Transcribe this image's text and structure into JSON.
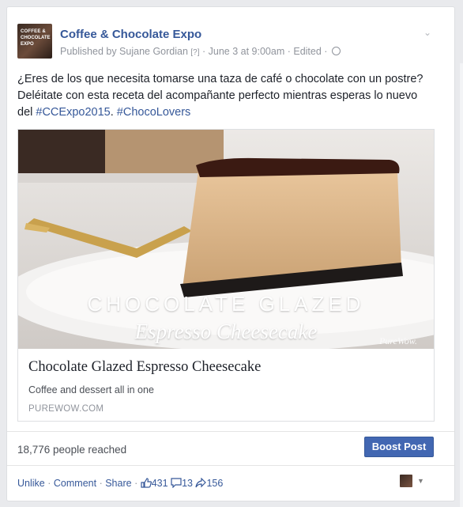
{
  "post": {
    "page_name": "Coffee & Chocolate Expo",
    "avatar_text": [
      "COFFEE &",
      "CHOCOLATE",
      "EXPO"
    ],
    "published_by": "Published by Sujane Gordian",
    "help_marker": "[?]",
    "date": "June 3 at 9:00am",
    "edited": "Edited",
    "text_main": "¿Eres de los que necesita tomarse una taza de café o chocolate con un postre? Deléitate con esta receta del acompañante perfecto mientras esperas lo nuevo del ",
    "hashtag1": "#CCExpo2015",
    "hashtag2": "#ChocoLovers",
    "privacy_icon": "globe-icon"
  },
  "link_card": {
    "image_title_line1": "CHOCOLATE GLAZED",
    "image_title_line2": "Espresso Cheesecake",
    "watermark": "PureWow.",
    "title": "Chocolate Glazed Espresso Cheesecake",
    "description": "Coffee and dessert all in one",
    "domain": "PUREWOW.COM"
  },
  "stats": {
    "reach": "18,776 people reached",
    "boost_label": "Boost Post"
  },
  "actions": {
    "unlike": "Unlike",
    "comment": "Comment",
    "share": "Share",
    "likes": "431",
    "comments": "13",
    "shares": "156"
  },
  "colors": {
    "link": "#365899",
    "boost": "#4267b2",
    "text": "#1d2129",
    "meta": "#90949c"
  }
}
